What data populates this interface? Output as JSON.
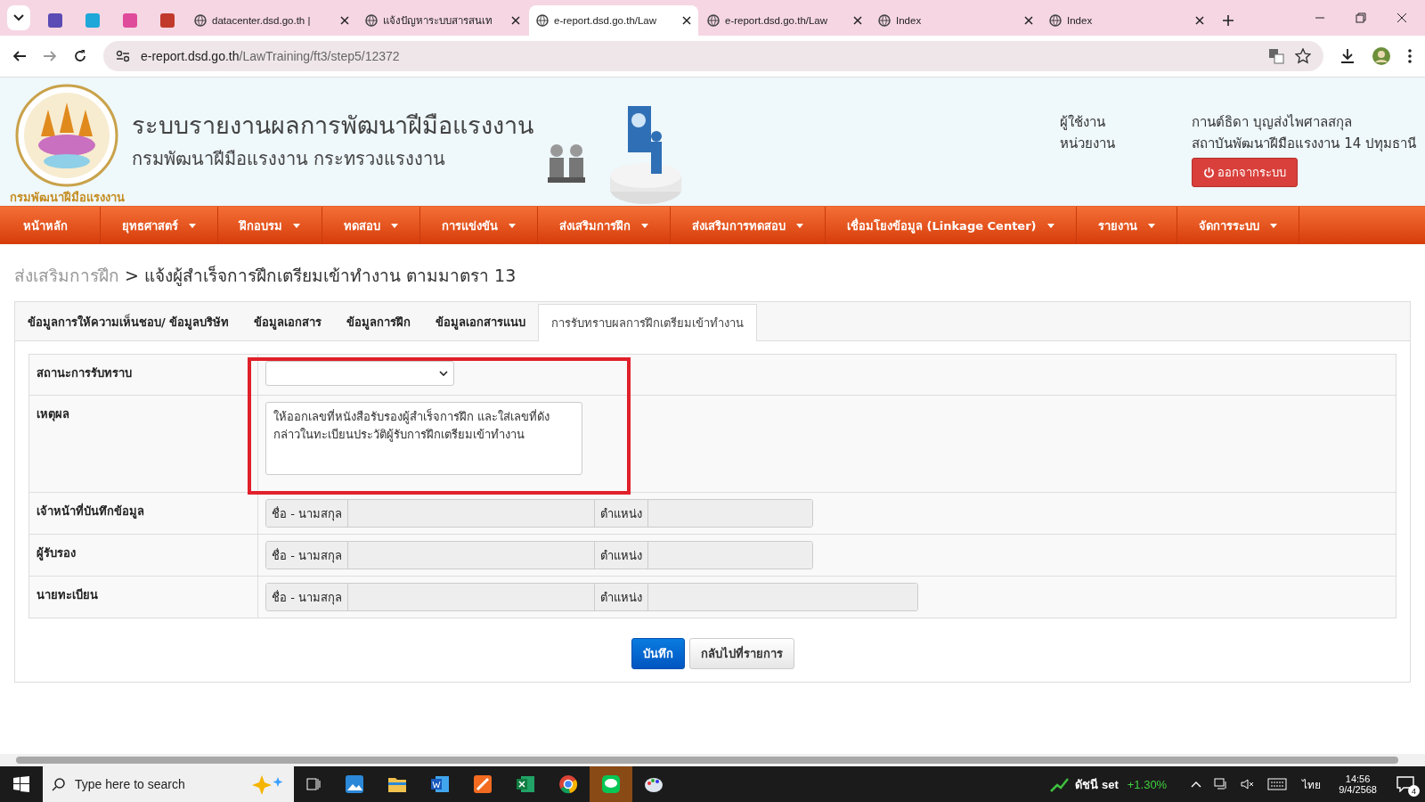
{
  "browser": {
    "tabs": [
      {
        "kind": "icon",
        "selected": false,
        "color": "#5b4bb5"
      },
      {
        "kind": "icon",
        "selected": false,
        "color": "#1ea7d8"
      },
      {
        "kind": "icon",
        "selected": false,
        "color": "#e04a9a"
      },
      {
        "kind": "icon",
        "selected": false,
        "color": "#c0392b"
      },
      {
        "kind": "page",
        "label": "datacenter.dsd.go.th |",
        "selected": false
      },
      {
        "kind": "page",
        "label": "แจ้งปัญหาระบบสารสนเท",
        "selected": false
      },
      {
        "kind": "page",
        "label": "e-report.dsd.go.th/Law",
        "selected": true
      },
      {
        "kind": "page",
        "label": "e-report.dsd.go.th/Law",
        "selected": false
      },
      {
        "kind": "page",
        "label": "Index",
        "selected": false
      },
      {
        "kind": "page",
        "label": "Index",
        "selected": false
      }
    ],
    "address": {
      "host": "e-report.dsd.go.th",
      "path": "/LawTraining/ft3/step5/12372"
    }
  },
  "header": {
    "title": "ระบบรายงานผลการพัฒนาฝีมือแรงงาน",
    "subtitle": "กรมพัฒนาฝีมือแรงงาน กระทรวงแรงงาน",
    "logo_text": "กรมพัฒนาฝีมือแรงงาน",
    "user": [
      {
        "label": "ผู้ใช้งาน",
        "value": "กานต์ธิดา บุญส่งไพศาลสกุล"
      },
      {
        "label": "หน่วยงาน",
        "value": "สถาบันพัฒนาฝีมือแรงงาน 14 ปทุมธานี"
      }
    ],
    "logout": "ออกจากระบบ"
  },
  "nav": [
    {
      "label": "หน้าหลัก",
      "dropdown": false
    },
    {
      "label": "ยุทธศาสตร์",
      "dropdown": true
    },
    {
      "label": "ฝึกอบรม",
      "dropdown": true
    },
    {
      "label": "ทดสอบ",
      "dropdown": true
    },
    {
      "label": "การแข่งขัน",
      "dropdown": true
    },
    {
      "label": "ส่งเสริมการฝึก",
      "dropdown": true
    },
    {
      "label": "ส่งเสริมการทดสอบ",
      "dropdown": true
    },
    {
      "label": "เชื่อมโยงข้อมูล (Linkage Center)",
      "dropdown": true
    },
    {
      "label": "รายงาน",
      "dropdown": true
    },
    {
      "label": "จัดการระบบ",
      "dropdown": true
    }
  ],
  "breadcrumb": {
    "parent": "ส่งเสริมการฝึก",
    "current": "> แจ้งผู้สำเร็จการฝึกเตรียมเข้าทำงาน ตามมาตรา 13"
  },
  "tabs": [
    {
      "label": "ข้อมูลการให้ความเห็นชอบ/ ข้อมูลบริษัท",
      "selected": false
    },
    {
      "label": "ข้อมูลเอกสาร",
      "selected": false
    },
    {
      "label": "ข้อมูลการฝึก",
      "selected": false
    },
    {
      "label": "ข้อมูลเอกสารแนบ",
      "selected": false
    },
    {
      "label": "การรับทราบผลการฝึกเตรียมเข้าทำงาน",
      "selected": true
    }
  ],
  "form": {
    "highlight_box": true,
    "rows": [
      {
        "kind": "select",
        "label": "สถานะการรับทราบ"
      },
      {
        "kind": "textarea",
        "label": "เหตุผล",
        "value": "ให้ออกเลขที่หนังสือรับรองผู้สำเร็จการฝึก  และใส่เลขที่ดังกล่าวในทะเบียนประวัติผู้รับการฝึกเตรียมเข้าทำงาน"
      },
      {
        "kind": "person",
        "label": "เจ้าหน้าที่บันทึกข้อมูล",
        "name_label": "ชื่อ - นามสกุล",
        "position_label": "ตำแหน่ง",
        "wide": false
      },
      {
        "kind": "person",
        "label": "ผู้รับรอง",
        "name_label": "ชื่อ - นามสกุล",
        "position_label": "ตำแหน่ง",
        "wide": false
      },
      {
        "kind": "person",
        "label": "นายทะเบียน",
        "name_label": "ชื่อ - นามสกุล",
        "position_label": "ตำแหน่ง",
        "wide": true
      }
    ]
  },
  "buttons": [
    {
      "kind": "primary",
      "label": "บันทึก"
    },
    {
      "kind": "default",
      "label": "กลับไปที่รายการ"
    }
  ],
  "taskbar": {
    "search_placeholder": "Type here to search",
    "stock_name": "ดัชนี set",
    "stock_change": "+1.30%",
    "language": "ไทย",
    "time": "14:56",
    "date": "9/4/2568",
    "notifications": "4"
  }
}
